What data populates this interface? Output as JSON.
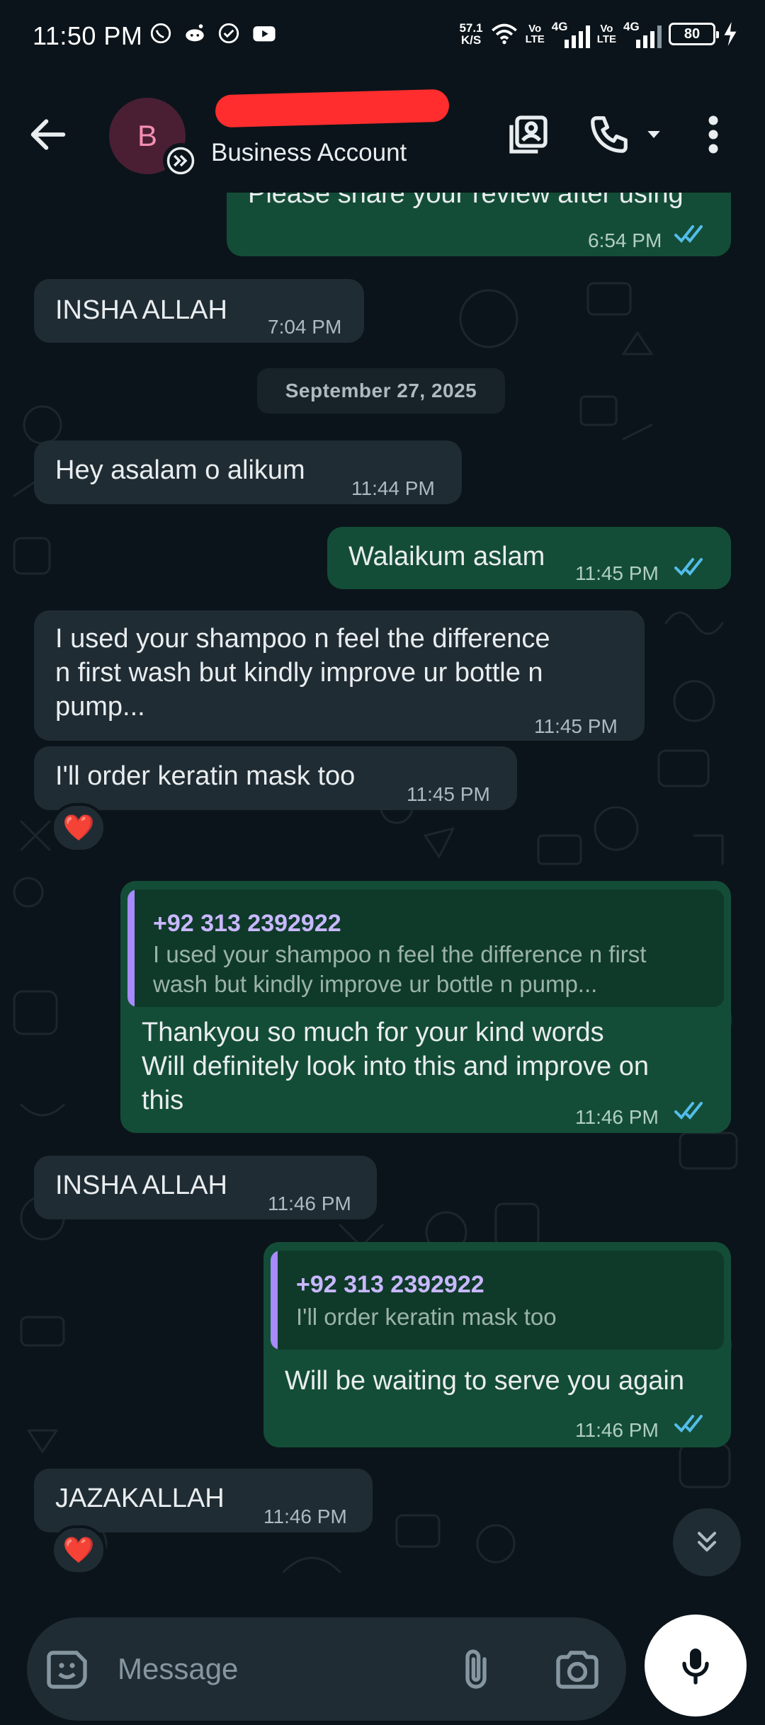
{
  "status_bar": {
    "time": "11:50 PM",
    "net_speed_value": "57.1",
    "net_speed_unit": "K/S",
    "volte_1_top": "Vo",
    "volte_1_bottom": "LTE",
    "net_1": "4G",
    "volte_2_top": "Vo",
    "volte_2_bottom": "LTE",
    "net_2": "4G",
    "battery": "80",
    "icons": [
      "whatsapp-icon",
      "reddit-icon",
      "check-circle-icon",
      "youtube-icon",
      "wifi-icon",
      "signal-icon",
      "charging-icon"
    ]
  },
  "header": {
    "avatar_letter": "B",
    "subtitle": "Business Account",
    "icons": [
      "back-arrow-icon",
      "business-badge-icon",
      "contact-card-icon",
      "phone-icon",
      "dropdown-arrow-icon",
      "more-vert-icon"
    ],
    "accent": "#f48fb1"
  },
  "messages": [
    {
      "dir": "out",
      "text": "Please share your review after using",
      "time": "6:54 PM",
      "read": true
    },
    {
      "dir": "in",
      "text": "INSHA ALLAH",
      "time": "7:04 PM"
    },
    {
      "dir": "date",
      "text": "September 27, 2025"
    },
    {
      "dir": "in",
      "text": "Hey asalam o alikum",
      "time": "11:44 PM"
    },
    {
      "dir": "out",
      "text": "Walaikum aslam",
      "time": "11:45 PM",
      "read": true
    },
    {
      "dir": "in",
      "lines": [
        "I used your shampoo n feel the difference",
        "n first wash but kindly improve ur bottle n",
        "pump..."
      ],
      "time": "11:45 PM"
    },
    {
      "dir": "in",
      "text": "I'll order keratin mask too",
      "time": "11:45 PM",
      "reaction": "❤️"
    },
    {
      "dir": "out",
      "quote": {
        "name": "+92 313 2392922",
        "lines": [
          "I used your shampoo n feel the difference n first",
          "wash but kindly improve ur bottle n pump..."
        ]
      },
      "lines": [
        "Thankyou so much for your kind words",
        "Will definitely look into this and improve on",
        "this"
      ],
      "time": "11:46 PM",
      "read": true
    },
    {
      "dir": "in",
      "text": "INSHA ALLAH",
      "time": "11:46 PM"
    },
    {
      "dir": "out",
      "quote": {
        "name": "+92 313 2392922",
        "text": "I'll order keratin mask too"
      },
      "text": "Will be waiting to serve you again",
      "time": "11:46 PM",
      "read": true
    },
    {
      "dir": "in",
      "text": "JAZAKALLAH",
      "time": "11:46 PM",
      "reaction": "❤️"
    }
  ],
  "composer": {
    "placeholder": "Message",
    "icons": [
      "sticker-icon",
      "attach-icon",
      "camera-icon",
      "mic-icon",
      "scroll-down-icon"
    ]
  },
  "colors": {
    "background": "#0b141a",
    "incoming_bubble": "#202c33",
    "outgoing_bubble": "#144d37",
    "read_ticks": "#53bdeb",
    "quote_bar": "#a78bfa"
  }
}
